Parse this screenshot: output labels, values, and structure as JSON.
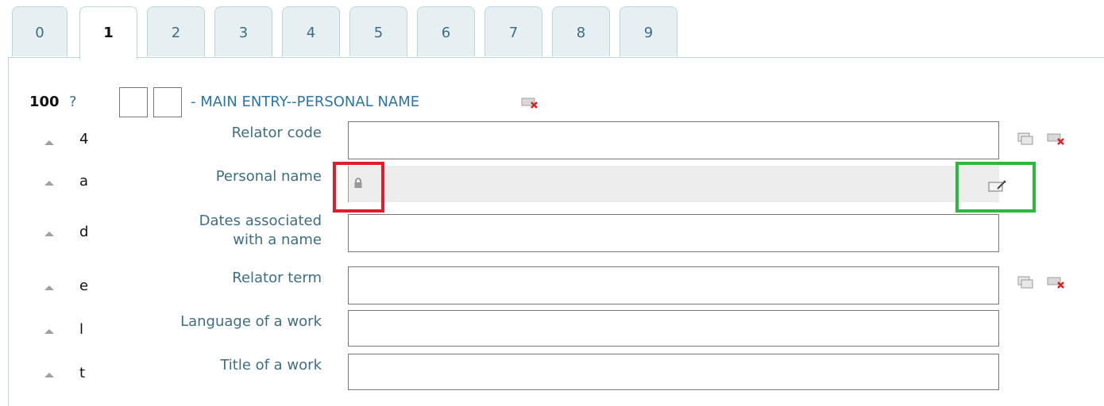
{
  "tabs": [
    {
      "label": "0",
      "active": false
    },
    {
      "label": "1",
      "active": true
    },
    {
      "label": "2",
      "active": false
    },
    {
      "label": "3",
      "active": false
    },
    {
      "label": "4",
      "active": false
    },
    {
      "label": "5",
      "active": false
    },
    {
      "label": "6",
      "active": false
    },
    {
      "label": "7",
      "active": false
    },
    {
      "label": "8",
      "active": false
    },
    {
      "label": "9",
      "active": false
    }
  ],
  "field": {
    "tag": "100",
    "help": "?",
    "title": "- MAIN ENTRY--PERSONAL NAME",
    "indicator1": "",
    "indicator2": ""
  },
  "subfields": [
    {
      "code": "4",
      "label": "Relator code",
      "value": ""
    },
    {
      "code": "a",
      "label": "Personal name",
      "value": "",
      "locked": true
    },
    {
      "code": "d",
      "label": "Dates associated with a name",
      "label_line1": "Dates associated",
      "label_line2": "with a name",
      "value": ""
    },
    {
      "code": "e",
      "label": "Relator term",
      "value": ""
    },
    {
      "code": "l",
      "label": "Language of a work",
      "value": ""
    },
    {
      "code": "t",
      "label": "Title of a work",
      "value": ""
    }
  ],
  "icons": {
    "delete_field": "delete-field-icon",
    "clone_subfield": "clone-subfield-icon",
    "delete_subfield": "delete-subfield-icon",
    "lock": "lock-icon",
    "authority_edit": "authority-edit-icon",
    "move_up": "arrow-up-icon"
  },
  "colors": {
    "tab_bg": "#e6f0f2",
    "link": "#3d6e86",
    "highlight_red": "#e11d2b",
    "highlight_green": "#2db83d",
    "locked_bg": "#ededed"
  }
}
